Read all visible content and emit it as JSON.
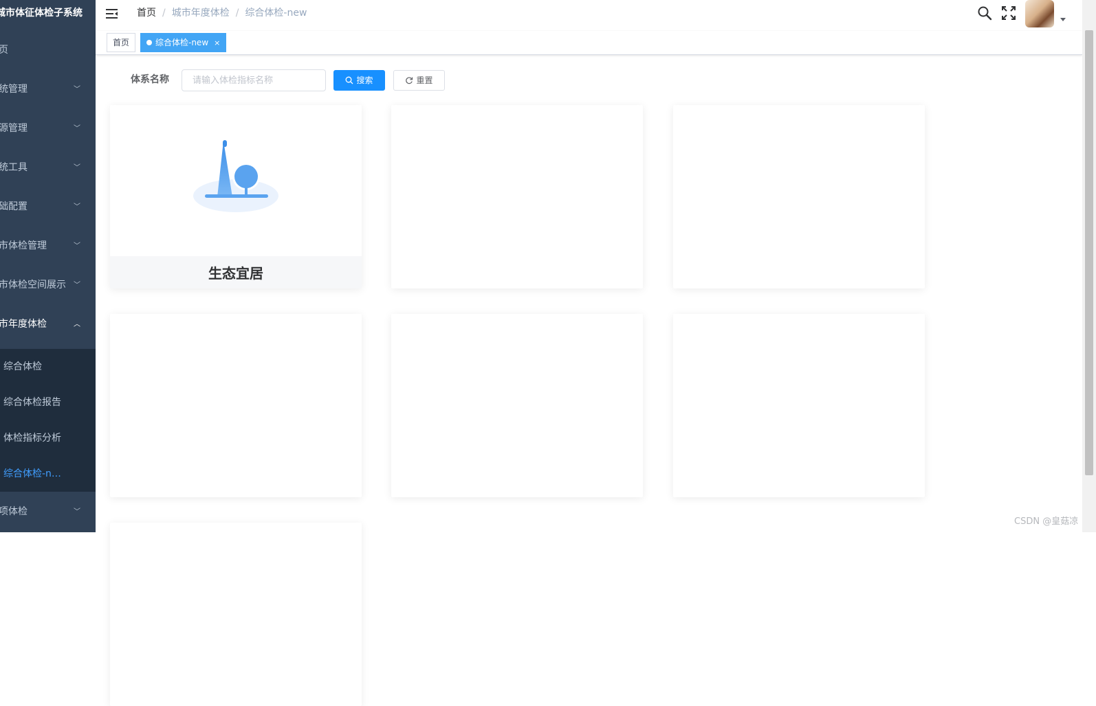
{
  "sidebar": {
    "title": "城市体征体检子系统",
    "items": [
      {
        "label": "页"
      },
      {
        "label": "统管理"
      },
      {
        "label": "源管理"
      },
      {
        "label": "统工具"
      },
      {
        "label": "础配置"
      },
      {
        "label": "市体检管理"
      },
      {
        "label": "市体检空间展示"
      },
      {
        "label": "市年度体检"
      },
      {
        "label": "项体检"
      }
    ],
    "subitems": [
      {
        "label": "综合体检"
      },
      {
        "label": "综合体检报告"
      },
      {
        "label": "体检指标分析"
      },
      {
        "label": "综合体检-n…"
      }
    ]
  },
  "breadcrumb": [
    "首页",
    "城市年度体检",
    "综合体检-new"
  ],
  "tags": [
    {
      "label": "首页"
    },
    {
      "label": "综合体检-new",
      "close": "×"
    }
  ],
  "search": {
    "label": "体系名称",
    "placeholder": "请输入体检指标名称",
    "search_button": "搜索",
    "reset_button": "重置"
  },
  "cards": [
    {
      "title": "生态宜居",
      "icon": "eco-livable-icon"
    },
    {
      "title": ""
    },
    {
      "title": ""
    },
    {
      "title": ""
    },
    {
      "title": ""
    },
    {
      "title": ""
    },
    {
      "title": ""
    }
  ],
  "watermark": "CSDN @皇菇凉",
  "colors": {
    "sidebar_bg": "#304156",
    "submenu_bg": "#1f2d3d",
    "active_menu": "#409eff",
    "primary_button": "#1890ff",
    "active_tag": "#42a5f5"
  }
}
